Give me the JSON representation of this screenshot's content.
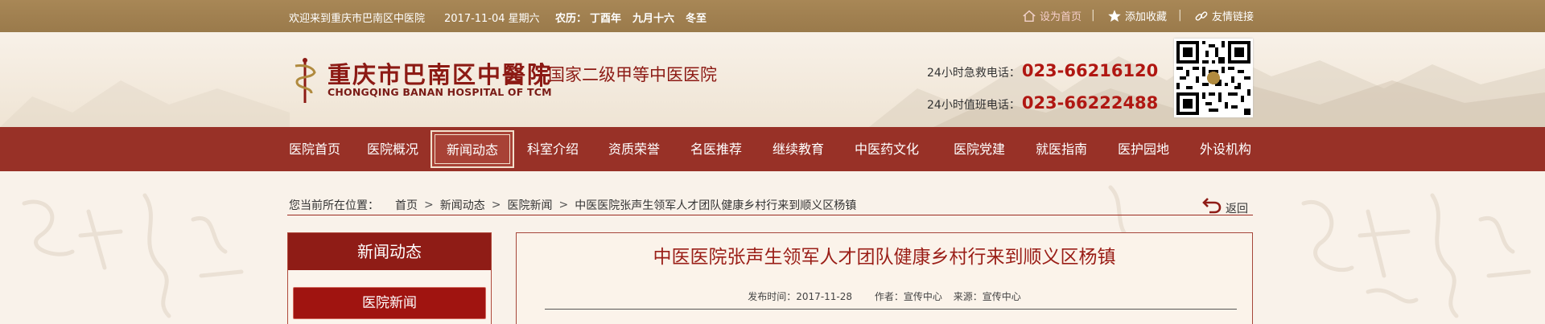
{
  "topbar": {
    "welcome": "欢迎来到重庆市巴南区中医院",
    "date": "2017-11-04 星期六",
    "lunar_label": "农历：",
    "lunar_year": "丁酉年",
    "lunar_day": "九月十六",
    "solar_term": "冬至",
    "links": [
      {
        "label": "设为首页",
        "icon": "home-icon",
        "highlight": true
      },
      {
        "label": "添加收藏",
        "icon": "star-icon"
      },
      {
        "label": "友情链接",
        "icon": "link-icon"
      }
    ]
  },
  "header": {
    "logo_cn": "重庆市巴南区中醫院",
    "logo_en": "CHONGQING BANAN HOSPITAL OF TCM",
    "grade": "国家二级甲等中医医院",
    "emergency_label": "24小时急救电话：",
    "emergency_number": "023-66216120",
    "duty_label": "24小时值班电话：",
    "duty_number": "023-66222488"
  },
  "nav": {
    "items": [
      "医院首页",
      "医院概况",
      "新闻动态",
      "科室介绍",
      "资质荣誉",
      "名医推荐",
      "继续教育",
      "中医药文化",
      "医院党建",
      "就医指南",
      "医护园地",
      "外设机构"
    ],
    "active_index": 2
  },
  "breadcrumb": {
    "label": "您当前所在位置：",
    "items": [
      "首页",
      "新闻动态",
      "医院新闻",
      "中医医院张声生领军人才团队健康乡村行来到顺义区杨镇"
    ],
    "back_label": "返回"
  },
  "sidebar": {
    "title": "新闻动态",
    "items": [
      "医院新闻"
    ]
  },
  "article": {
    "title": "中医医院张声生领军人才团队健康乡村行来到顺义区杨镇",
    "publish": "发布时间：2017-11-28",
    "author": "作者：宣传中心",
    "source": "来源：宣传中心"
  },
  "colors": {
    "topbar": "#a88756",
    "nav": "#983127",
    "accent": "#9a1e17",
    "phone": "#b01712"
  }
}
